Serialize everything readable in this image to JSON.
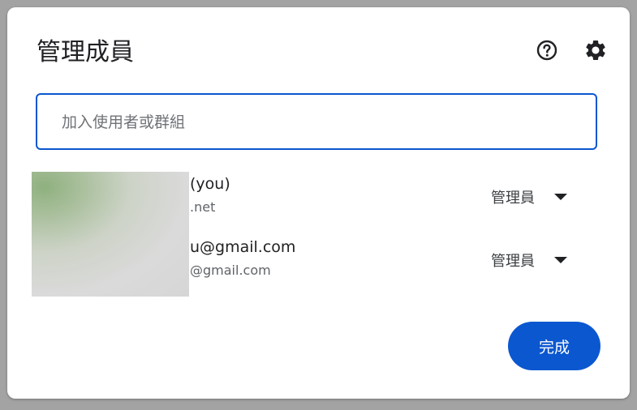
{
  "dialog": {
    "title": "管理成員",
    "help_icon": "help-circle-icon",
    "settings_icon": "gear-icon",
    "accent_color": "#0b57d0"
  },
  "search": {
    "placeholder": "加入使用者或群組",
    "value": ""
  },
  "members": [
    {
      "name": "(you)",
      "email": ".net",
      "role": "管理員"
    },
    {
      "name": "u@gmail.com",
      "email": "@gmail.com",
      "role": "管理員"
    }
  ],
  "actions": {
    "done_label": "完成"
  }
}
